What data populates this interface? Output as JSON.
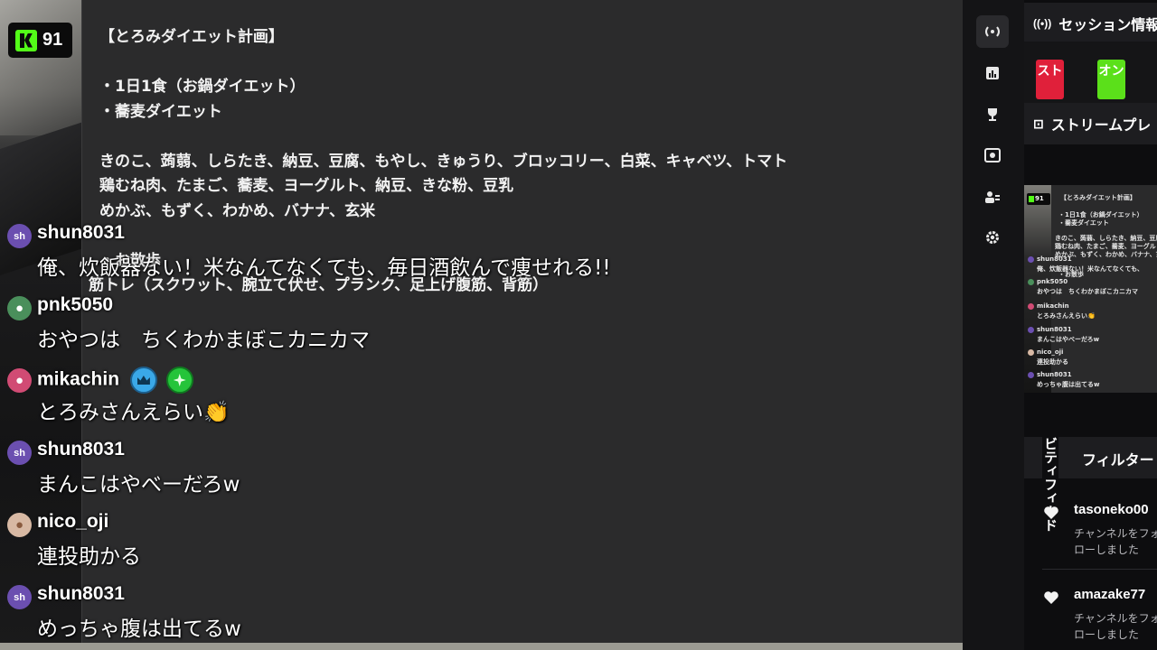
{
  "logo": {
    "count": "91"
  },
  "document": {
    "lines": [
      "【とろみダイエット計画】",
      "",
      "・1日1食（お鍋ダイエット）",
      "・蕎麦ダイエット",
      "",
      "きのこ、蒟蒻、しらたき、納豆、豆腐、もやし、きゅうり、ブロッコリー、白菜、キャベツ、トマト",
      "鶏むね肉、たまご、蕎麦、ヨーグルト、納豆、きな粉、豆乳",
      "めかぶ、もずく、わかめ、バナナ、玄米",
      "",
      "・お散歩",
      "筋トレ（スクワット、腕立て伏せ、プランク、足上げ腹筋、背筋）"
    ]
  },
  "chat": [
    {
      "user": "shun8031",
      "avatar": "sh",
      "avatar_color": "#6b4fb0",
      "text": "俺、炊飯器ない！米なんてなくても、毎日酒飲んで痩せれる!!"
    },
    {
      "user": "pnk5050",
      "avatar": "",
      "avatar_color": "#4a8f5b",
      "text": "おやつは　ちくわかまぼこカニカマ"
    },
    {
      "user": "mikachin",
      "avatar": "",
      "avatar_color": "#d14b74",
      "text": "とろみさんえらい👏"
    },
    {
      "user": "shun8031",
      "avatar": "sh",
      "avatar_color": "#6b4fb0",
      "text": "まんこはやべーだろw"
    },
    {
      "user": "nico_oji",
      "avatar": "",
      "avatar_color": "#d8b9a4",
      "text": "連投助かる"
    },
    {
      "user": "shun8031",
      "avatar": "sh",
      "avatar_color": "#6b4fb0",
      "text": "めっちゃ腹は出てるw"
    }
  ],
  "rail": {
    "icons": [
      "broadcast-icon",
      "chart-icon",
      "trophy-icon",
      "screen-capture-icon",
      "users-icon",
      "gear-icon"
    ]
  },
  "panels": {
    "session_title": "セッション情報",
    "session_pills": [
      "スト",
      "オン"
    ],
    "stream_preview_title": "ストリームプレ",
    "activity_tabs": "ビティフィード",
    "activity_filter": "フィルター",
    "follows": [
      {
        "user": "tasoneko00",
        "desc": "チャンネルをフォローしました"
      },
      {
        "user": "amazake77",
        "desc": "チャンネルをフォローしました"
      }
    ]
  },
  "thumbnail": {
    "badge": "91",
    "lines": [
      "【とろみダイエット計画】",
      "・1日1食（お鍋ダイエット）",
      "・蕎麦ダイエット",
      "きのこ、蒟蒻、しらたき、納豆、豆腐、もやし、",
      "鶏むね肉、たまご、蕎麦、ヨーグルト、納豆、",
      "めかぶ、もずく、わかめ、バナナ、玄米",
      "・お散歩"
    ],
    "chat": [
      {
        "user": "shun8031",
        "text": "俺、炊飯器ない！米なんてなくても、"
      },
      {
        "user": "pnk5050",
        "text": "おやつは　ちくわかまぼこカニカマ"
      },
      {
        "user": "mikachin",
        "text": "とろみさんえらい👏"
      },
      {
        "user": "shun8031",
        "text": "まんこはやべーだろw"
      },
      {
        "user": "nico_oji",
        "text": "連投助かる"
      },
      {
        "user": "shun8031",
        "text": "めっちゃ腹は出てるw"
      }
    ]
  },
  "colors": {
    "kick_green": "#53fc18",
    "pill_red": "#e0203a",
    "pill_green": "#5be01a"
  }
}
